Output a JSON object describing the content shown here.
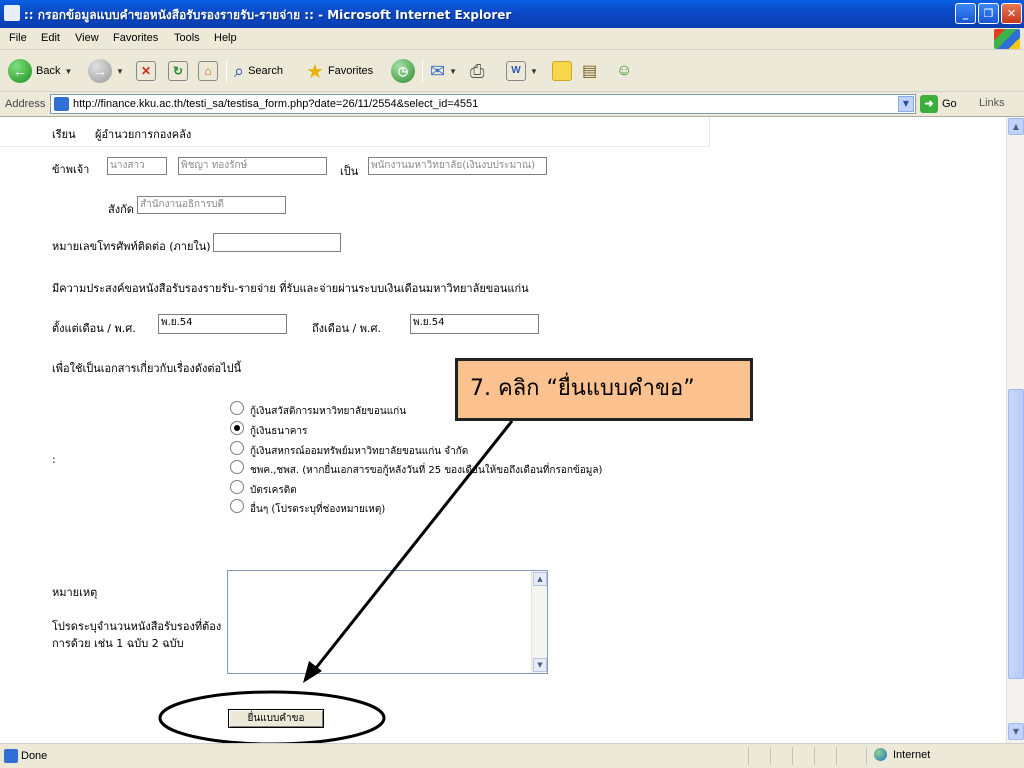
{
  "window": {
    "title": ":: กรอกข้อมูลแบบคำขอหนังสือรับรองรายรับ-รายจ่าย :: - Microsoft Internet Explorer"
  },
  "menu": [
    "File",
    "Edit",
    "View",
    "Favorites",
    "Tools",
    "Help"
  ],
  "toolbar": {
    "back": "Back",
    "search": "Search",
    "favorites": "Favorites"
  },
  "address": {
    "label": "Address",
    "url": "http://finance.kku.ac.th/testi_sa/testisa_form.php?date=26/11/2554&select_id=4551",
    "go": "Go",
    "links": "Links"
  },
  "form": {
    "to_label": "เรียน",
    "to_value": "ผู้อำนวยการกองคลัง",
    "me_label": "ข้าพเจ้า",
    "title_value": "นางสาว",
    "name_value": "พิชญา ทองรักษ์",
    "as_label": "เป็น",
    "position_value": "พนักงานมหาวิทยาลัย(เงินงบประมาณ)",
    "dept_label": "สังกัด",
    "dept_value": "สำนักงานอธิการบดี",
    "phone_label": "หมายเลขโทรศัพท์ติดต่อ (ภายใน)",
    "phone_value": "",
    "purpose_text": "มีความประสงค์ขอหนังสือรับรองรายรับ-รายจ่าย  ที่รับและจ่ายผ่านระบบเงินเดือนมหาวิทยาลัยขอนแก่น",
    "from_label": "ตั้งแต่เดือน / พ.ศ.",
    "from_value": "พ.ย.54",
    "until_label": "ถึงเดือน / พ.ศ.",
    "until_value": "พ.ย.54",
    "use_for_label": "เพื่อใช้เป็นเอกสารเกี่ยวกับเรื่องดังต่อไปนี้",
    "colon": ":",
    "options": [
      {
        "label": "กู้เงินสวัสดิการมหาวิทยาลัยขอนแก่น",
        "checked": false
      },
      {
        "label": "กู้เงินธนาคาร",
        "checked": true
      },
      {
        "label": "กู้เงินสหกรณ์ออมทรัพย์มหาวิทยาลัยขอนแก่น จำกัด",
        "checked": false
      },
      {
        "label": "ชพค.,ชพส. (หากยื่นเอกสารขอกู้หลังวันที่ 25 ของเดือนให้ขอถึงเดือนที่กรอกข้อมูล)",
        "checked": false
      },
      {
        "label": "บัตรเครดิต",
        "checked": false
      },
      {
        "label": "อื่นๆ (โปรดระบุที่ช่องหมายเหตุ)",
        "checked": false
      }
    ],
    "note_label": "หมายเหตุ",
    "note_hint_line1": "โปรดระบุจำนวนหนังสือรับรองที่ต้อง",
    "note_hint_line2": "การด้วย เช่น 1 ฉบับ 2 ฉบับ",
    "note_value": "",
    "submit_label": "ยื่นแบบคำขอ"
  },
  "annotation": {
    "callout_text": "7. คลิก “ยื่นแบบคำขอ”",
    "color_fill": "#fbc18e"
  },
  "status": {
    "done": "Done",
    "zone": "Internet"
  }
}
